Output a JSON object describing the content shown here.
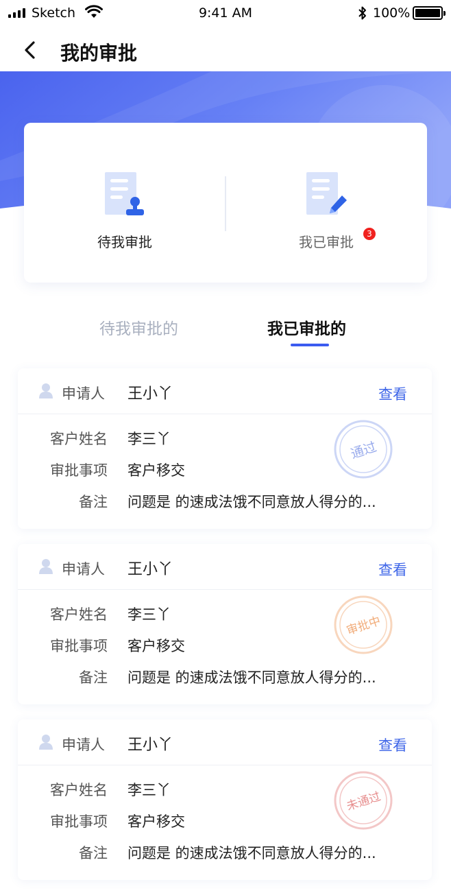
{
  "status_bar": {
    "carrier": "Sketch",
    "time": "9:41 AM",
    "battery": "100%"
  },
  "nav": {
    "title": "我的审批"
  },
  "summary": {
    "pending_label": "待我审批",
    "done_label": "我已审批",
    "done_badge": "3"
  },
  "tabs": {
    "pending": "待我审批的",
    "done": "我已审批的",
    "active": "done"
  },
  "records": [
    {
      "applicant_label": "申请人",
      "applicant": "王小丫",
      "view": "查看",
      "customer_label": "客户姓名",
      "customer": "李三丫",
      "matter_label": "审批事项",
      "matter": "客户移交",
      "note_label": "备注",
      "note": "问题是 的速成法饿不同意放人得分的...",
      "status": "通过",
      "status_color": "#8fa3ea"
    },
    {
      "applicant_label": "申请人",
      "applicant": "王小丫",
      "view": "查看",
      "customer_label": "客户姓名",
      "customer": "李三丫",
      "matter_label": "审批事项",
      "matter": "客户移交",
      "note_label": "备注",
      "note": "问题是 的速成法饿不同意放人得分的...",
      "status": "审批中",
      "status_color": "#f0a46c"
    },
    {
      "applicant_label": "申请人",
      "applicant": "王小丫",
      "view": "查看",
      "customer_label": "客户姓名",
      "customer": "李三丫",
      "matter_label": "审批事项",
      "matter": "客户移交",
      "note_label": "备注",
      "note": "问题是 的速成法饿不同意放人得分的...",
      "status": "未通过",
      "status_color": "#e58383"
    }
  ],
  "colors": {
    "accent": "#3b5bf0",
    "hero_start": "#4a63ee",
    "hero_end": "#7e95f8",
    "badge": "#f0221f"
  }
}
